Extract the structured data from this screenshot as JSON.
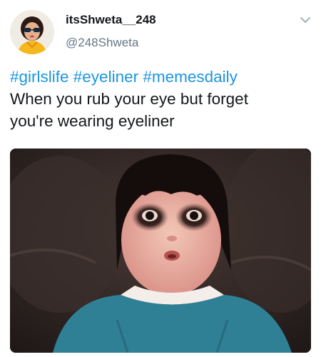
{
  "tweet": {
    "user": {
      "display_name": "itsShweta__248",
      "handle": "@248Shweta"
    },
    "hashtags_line": "#girlslife #eyeliner #memesdaily",
    "body_line_1": "When you rub your eye but forget",
    "body_line_2": "you're wearing eyeliner"
  },
  "icons": {
    "menu": "chevron-down-icon"
  },
  "colors": {
    "hashtag": "#1b95e0",
    "handle": "#657786",
    "text": "#14171a"
  }
}
